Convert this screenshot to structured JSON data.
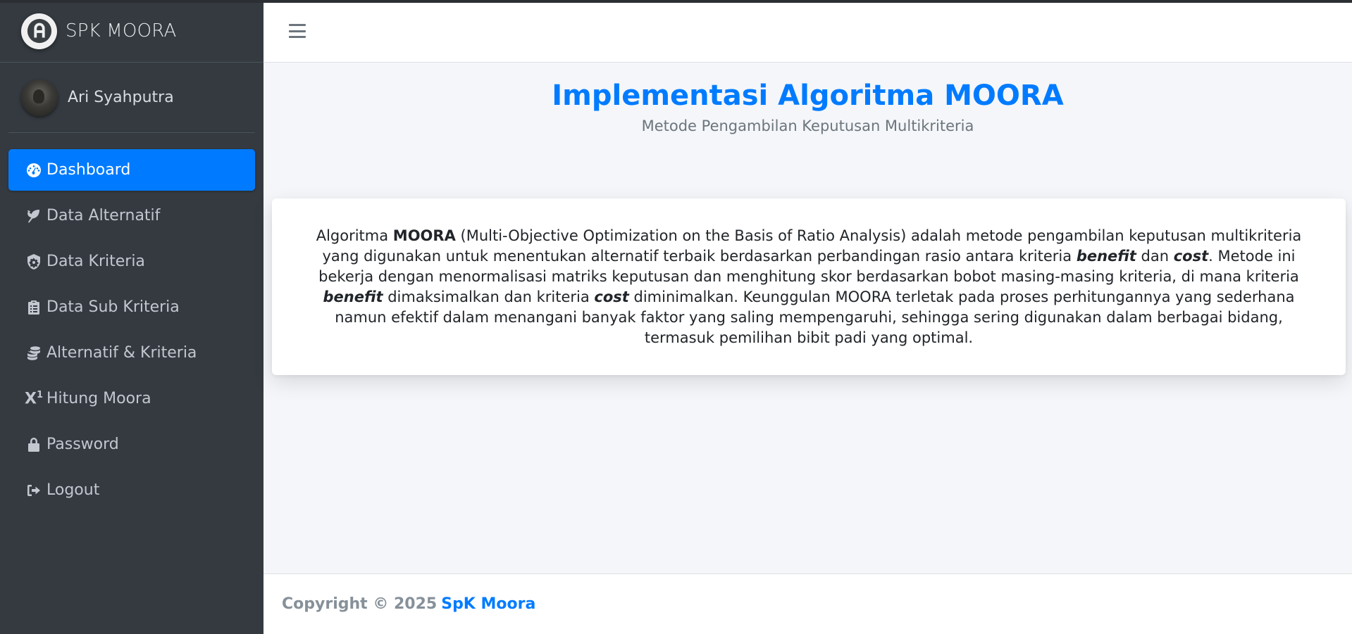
{
  "brand": {
    "title": "SPK MOORA"
  },
  "user": {
    "name": "Ari Syahputra"
  },
  "sidebar": {
    "items": [
      {
        "label": "Dashboard",
        "icon": "tachometer-icon",
        "active": true
      },
      {
        "label": "Data Alternatif",
        "icon": "seedling-icon",
        "active": false
      },
      {
        "label": "Data Kriteria",
        "icon": "shield-gear-icon",
        "active": false
      },
      {
        "label": "Data Sub Kriteria",
        "icon": "clipboard-list-icon",
        "active": false
      },
      {
        "label": "Alternatif & Kriteria",
        "icon": "coins-stack-icon",
        "active": false
      },
      {
        "label": "Hitung Moora",
        "icon": "superscript-icon",
        "active": false
      },
      {
        "label": "Password",
        "icon": "lock-icon",
        "active": false
      },
      {
        "label": "Logout",
        "icon": "sign-out-icon",
        "active": false
      }
    ]
  },
  "header": {
    "menu_icon": "hamburger-icon"
  },
  "main": {
    "title": "Implementasi Algoritma MOORA",
    "subtitle": "Metode Pengambilan Keputusan Multikriteria",
    "description": {
      "p1": "Algoritma ",
      "b1": "MOORA",
      "p2": " (Multi-Objective Optimization on the Basis of Ratio Analysis) adalah metode pengambilan keputusan multikriteria yang digunakan untuk menentukan alternatif terbaik berdasarkan perbandingan rasio antara kriteria ",
      "e1": "benefit",
      "p3": " dan ",
      "e2": "cost",
      "p4": ". Metode ini bekerja dengan menormalisasi matriks keputusan dan menghitung skor berdasarkan bobot masing-masing kriteria, di mana kriteria ",
      "e3": "benefit",
      "p5": " dimaksimalkan dan kriteria ",
      "e4": "cost",
      "p6": " diminimalkan. Keunggulan MOORA terletak pada proses perhitungannya yang sederhana namun efektif dalam menangani banyak faktor yang saling mempengaruhi, sehingga sering digunakan dalam berbagai bidang, termasuk pemilihan bibit padi yang optimal."
    }
  },
  "footer": {
    "copyright": "Copyright © 2025",
    "brand": "SpK Moora"
  },
  "colors": {
    "accent": "#007bff",
    "sidebar_bg": "#343a40",
    "content_bg": "#f4f6f9"
  }
}
